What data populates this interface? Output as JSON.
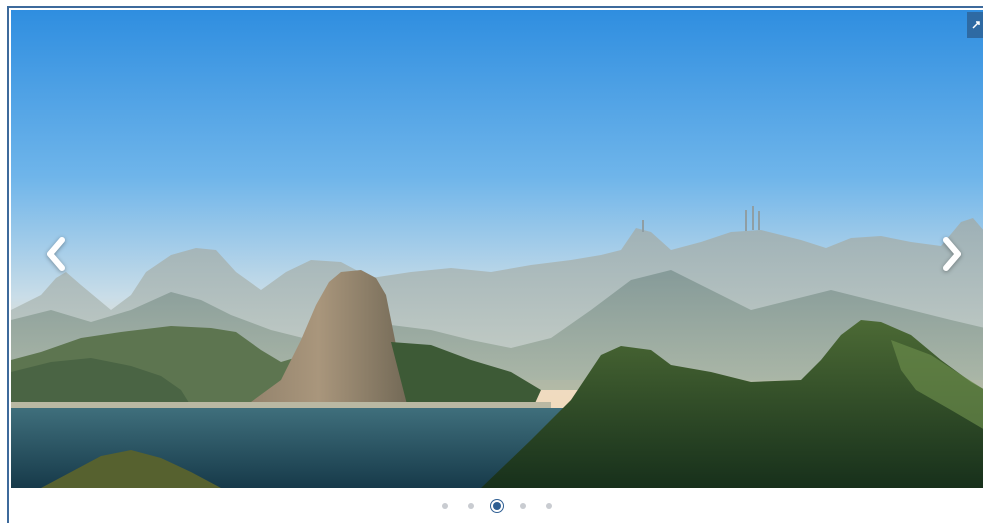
{
  "slider": {
    "image_description_icon": "landscape-photo",
    "prev_icon": "chevron-left-icon",
    "next_icon": "chevron-right-icon",
    "expand_icon": "expand-icon",
    "dot_count": 5,
    "active_index": 2
  },
  "colors": {
    "frame_border": "#3d6a9c",
    "expand_bg": "#2e6aa3",
    "dot_inactive": "#c9ccd1",
    "dot_active": "#2f5f93"
  }
}
